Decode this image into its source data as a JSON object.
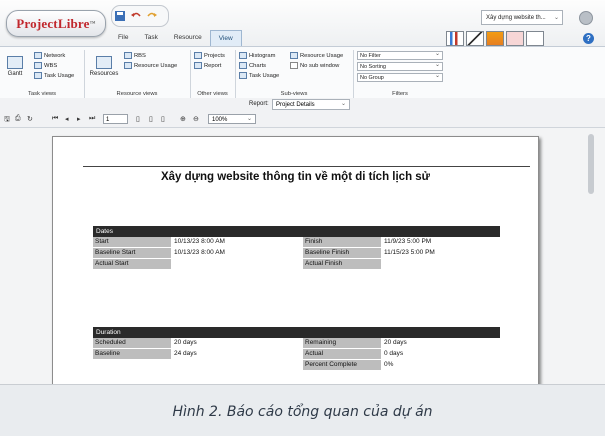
{
  "app": {
    "logo_text": "ProjectLibre",
    "logo_suffix": "™",
    "tabs": [
      "File",
      "Task",
      "Resource",
      "View"
    ],
    "project_select": "Xây dựng website th...",
    "help": "?"
  },
  "ribbon": {
    "task_views": {
      "label": "Task views",
      "gantt": "Gantt",
      "network": "Network",
      "wbs": "WBS",
      "task_usage": "Task Usage"
    },
    "resource_views": {
      "label": "Resource views",
      "resources": "Resources",
      "rbs": "RBS",
      "resource_usage": "Resource Usage"
    },
    "other_views": {
      "label": "Other views",
      "projects": "Projects",
      "report": "Report"
    },
    "sub_views": {
      "label": "Sub-views",
      "histogram": "Histogram",
      "charts": "Charts",
      "task_usage": "Task Usage",
      "resource_usage": "Resource Usage",
      "no_sub_window": "No sub window"
    },
    "filters": {
      "label": "Filters",
      "filter": "No Filter",
      "sorting": "No Sorting",
      "group": "No Group"
    }
  },
  "reportbar": {
    "label": "Report:",
    "value": "Project Details"
  },
  "toolbar": {
    "page": "1",
    "zoom": "100%"
  },
  "document": {
    "title": "Xây dựng website thông tin về một di tích lịch sử",
    "dates": {
      "header": "Dates",
      "start_label": "Start",
      "start_value": "10/13/23 8:00 AM",
      "baseline_start_label": "Baseline Start",
      "baseline_start_value": "10/13/23 8:00 AM",
      "actual_start_label": "Actual Start",
      "finish_label": "Finish",
      "finish_value": "11/9/23 5:00 PM",
      "baseline_finish_label": "Baseline Finish",
      "baseline_finish_value": "11/15/23 5:00 PM",
      "actual_finish_label": "Actual Finish"
    },
    "duration": {
      "header": "Duration",
      "scheduled_label": "Scheduled",
      "scheduled_value": "20 days",
      "baseline_label": "Baseline",
      "baseline_value": "24 days",
      "remaining_label": "Remaining",
      "remaining_value": "20 days",
      "actual_label": "Actual",
      "actual_value": "0 days",
      "percent_label": "Percent Complete",
      "percent_value": "0%"
    }
  },
  "caption": "Hình 2. Báo cáo tổng quan của dự án",
  "colors": {
    "logo_red": "#c1272d",
    "section_header": "#2a2a2a",
    "label_gray": "#bdbdbd",
    "accent_blue": "#2e6fc2"
  }
}
